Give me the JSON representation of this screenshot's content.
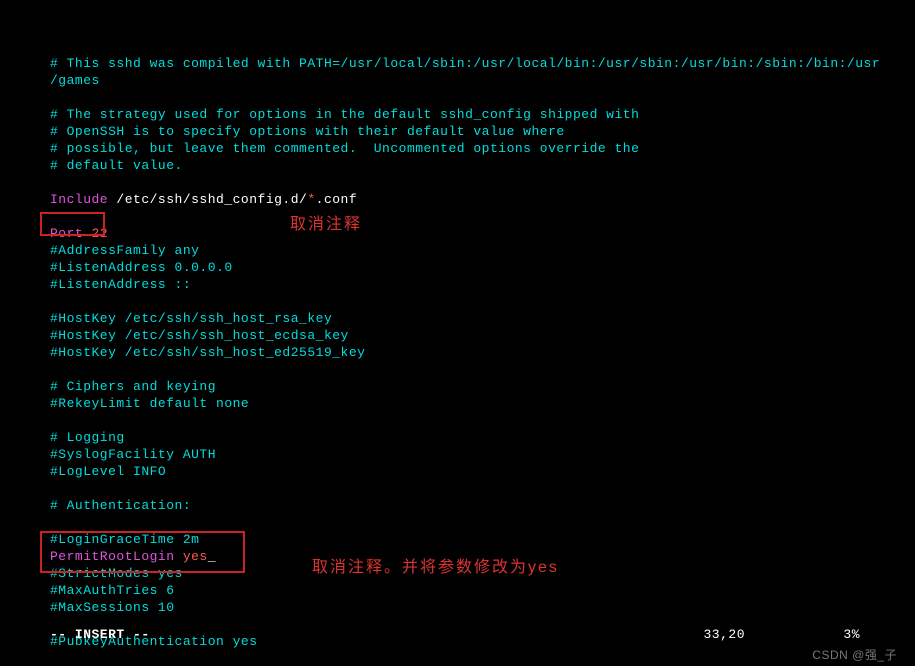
{
  "config": {
    "comment_path1": "# This sshd was compiled with PATH=/usr/local/sbin:/usr/local/bin:/usr/sbin:/usr/bin:/sbin:/bin:/usr",
    "comment_path2": "/games",
    "comment_strategy1": "# The strategy used for options in the default sshd_config shipped with",
    "comment_strategy2": "# OpenSSH is to specify options with their default value where",
    "comment_strategy3": "# possible, but leave them commented.  Uncommented options override the",
    "comment_strategy4": "# default value.",
    "include_kw": "Include",
    "include_path": " /etc/ssh/sshd_config.d/",
    "include_glob": "*",
    "include_ext": ".conf",
    "port_kw": "Port",
    "port_val": " 22",
    "addressfamily": "#AddressFamily any",
    "listen1": "#ListenAddress 0.0.0.0",
    "listen2": "#ListenAddress ::",
    "hostkey1": "#HostKey /etc/ssh/ssh_host_rsa_key",
    "hostkey2": "#HostKey /etc/ssh/ssh_host_ecdsa_key",
    "hostkey3": "#HostKey /etc/ssh/ssh_host_ed25519_key",
    "ciphers_header": "# Ciphers and keying",
    "rekey": "#RekeyLimit default none",
    "logging_header": "# Logging",
    "syslog": "#SyslogFacility AUTH",
    "loglevel": "#LogLevel INFO",
    "auth_header": "# Authentication:",
    "logingrace": "#LoginGraceTime 2m",
    "permitroot_kw": "PermitRootLogin",
    "permitroot_val": " yes",
    "strictmodes": "#StrictModes yes",
    "maxauth": "#MaxAuthTries 6",
    "maxsessions": "#MaxSessions 10",
    "pubkey": "#PubkeyAuthentication yes"
  },
  "annotations": {
    "anno1": "取消注释",
    "anno2": "取消注释。并将参数修改为yes"
  },
  "status": {
    "mode": "-- INSERT --",
    "position": "33,20",
    "percent": "3%"
  },
  "watermark": "CSDN @强_子"
}
